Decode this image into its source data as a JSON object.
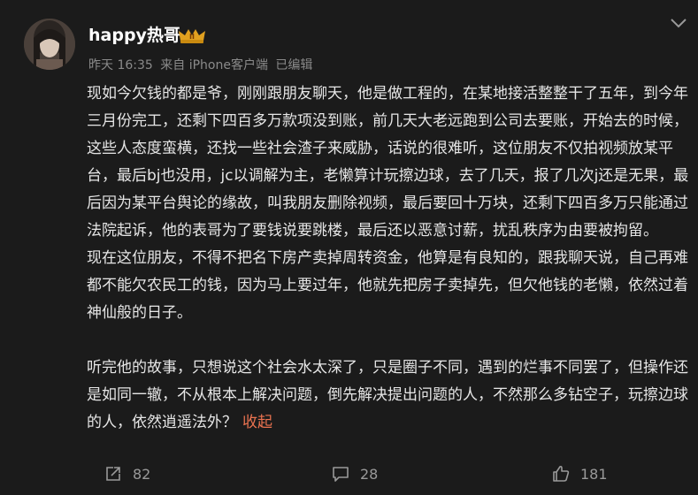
{
  "post": {
    "user_name": "happy热哥",
    "badge_label": "II",
    "time": "昨天 16:35",
    "source": "来自 iPhone客户端",
    "edited": "已编辑",
    "paragraphs": [
      "现如今欠钱的都是爷，刚刚跟朋友聊天，他是做工程的，在某地接活整整干了五年，到今年三月份完工，还剩下四百多万款项没到账，前几天大老远跑到公司去要账，开始去的时候，这些人态度蛮横，还找一些社会渣子来威胁，话说的很难听，这位朋友不仅拍视频放某平台，最后bj也没用，jc以调解为主，老懒算计玩擦边球，去了几天，报了几次j还是无果，最后因为某平台舆论的缘故，叫我朋友删除视频，最后要回十万块，还剩下四百多万只能通过法院起诉，他的表哥为了要钱说要跳楼，最后还以恶意讨薪，扰乱秩序为由要被拘留。",
      "现在这位朋友，不得不把名下房产卖掉周转资金，他算是有良知的，跟我聊天说，自己再难都不能欠农民工的钱，因为马上要过年，他就先把房子卖掉先，但欠他钱的老懒，依然过着神仙般的日子。",
      "听完他的故事，只想说这个社会水太深了，只是圈子不同，遇到的烂事不同罢了，但操作还是如同一辙，不从根本上解决问题，倒先解决提出问题的人，不然那么多钻空子，玩擦边球的人，依然逍遥法外？"
    ],
    "collapse_label": "收起"
  },
  "actions": {
    "share_count": "82",
    "comment_count": "28",
    "like_count": "181"
  },
  "colors": {
    "background": "#1b1b1b",
    "text": "#e6e6e6",
    "meta": "#8a8a8a",
    "link": "#eb7350",
    "badge": "#e0a020"
  },
  "icons": [
    "more-icon",
    "share-icon",
    "comment-icon",
    "like-icon"
  ]
}
